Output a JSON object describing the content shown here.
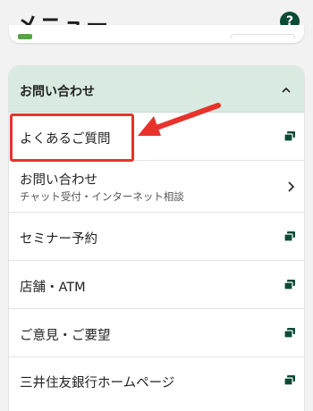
{
  "header": {
    "title": "メニュー",
    "help_icon": "question-circle-icon",
    "help_glyph": "?"
  },
  "section": {
    "title": "お問い合わせ",
    "expanded": true
  },
  "items": [
    {
      "label": "よくあるご質問",
      "icon": "external-link-icon"
    },
    {
      "label": "お問い合わせ",
      "sub": "チャット受付・インターネット相談",
      "icon": "chevron-right-icon"
    },
    {
      "label": "セミナー予約",
      "icon": "external-link-icon"
    },
    {
      "label": "店舗・ATM",
      "icon": "external-link-icon"
    },
    {
      "label": "ご意見・ご要望",
      "icon": "external-link-icon"
    },
    {
      "label": "三井住友銀行ホームページ",
      "icon": "external-link-icon"
    }
  ],
  "colors": {
    "brand_dark_green": "#0b4a36",
    "section_bg": "#d9ebe1",
    "annotation_red": "#e8322b"
  }
}
